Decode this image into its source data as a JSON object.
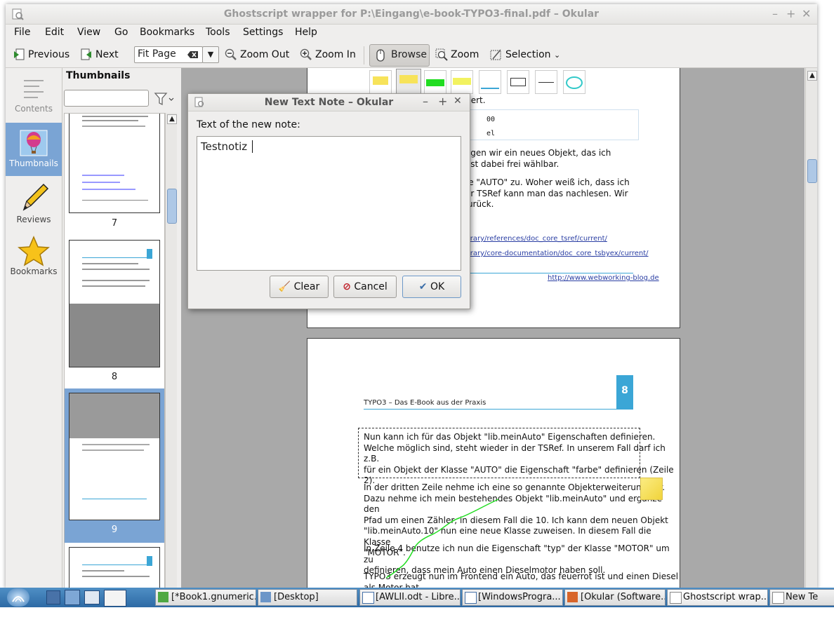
{
  "window": {
    "title": "Ghostscript wrapper for P:\\Eingang\\e-book-TYPO3-final.pdf – Okular"
  },
  "menu": [
    "File",
    "Edit",
    "View",
    "Go",
    "Bookmarks",
    "Tools",
    "Settings",
    "Help"
  ],
  "toolbar": {
    "previous": "Previous",
    "next": "Next",
    "zoom_mode": "Fit Page",
    "zoom_out": "Zoom Out",
    "zoom_in": "Zoom In",
    "browse": "Browse",
    "zoom": "Zoom",
    "selection": "Selection"
  },
  "sidebar": {
    "items": [
      {
        "label": "Contents"
      },
      {
        "label": "Thumbnails"
      },
      {
        "label": "Reviews"
      },
      {
        "label": "Bookmarks"
      }
    ]
  },
  "thumbnails": {
    "title": "Thumbnails",
    "pages": [
      "7",
      "8",
      "9"
    ]
  },
  "document": {
    "page_top": {
      "frag1": "mmiert.",
      "frag2": "00",
      "frag3": "el",
      "p1": [
        "rzeugen wir ein neues Objekt, das ich",
        "me ist dabei frei wählbar."
      ],
      "p2": [
        "lasse \"AUTO\" zu. Woher weiß ich, dass ich",
        "n der TSRef kann man das nachlesen. Wir",
        "uf zurück."
      ],
      "link1": "nt-library/references/doc_core_tsref/current/",
      "link2": "nt-library/core-documentation/doc_core_tsbyex/current/",
      "footer_link": "http://www.webworking-blog.de"
    },
    "page8": {
      "number": "8",
      "header": "TYPO3 – Das E-Book aus der Praxis",
      "box_para": [
        "Nun kann ich für das Objekt \"lib.meinAuto\" Eigenschaften definieren.",
        "Welche möglich sind, steht wieder in der TSRef. In unserem Fall darf ich z.B.",
        "für ein Objekt der Klasse \"AUTO\" die Eigenschaft \"farbe\" definieren (Zeile",
        "2)."
      ],
      "para2": [
        "In der dritten Zeile nehme ich eine so genannte Objekterweiterung vor.",
        "Dazu nehme ich mein bestehendes Objekt \"lib.meinAuto\" und ergänze den",
        "Pfad um einen Zähler, in diesem Fall die 10. Ich kann dem neuen Objekt",
        "\"lib.meinAuto.10\" nun eine neue Klasse zuweisen. In diesem Fall die Klasse",
        "\"MOTOR\"."
      ],
      "para3": [
        "In Zeile 4 benutze ich nun die Eigenschaft \"typ\" der Klasse \"MOTOR\" um zu",
        "definieren, dass mein Auto einen Dieselmotor haben soll."
      ],
      "para4": [
        "TYPO3 erzeugt nun im Frontend ein Auto, das feuerrot ist und einen Diesel",
        "als Motor hat."
      ]
    }
  },
  "dialog": {
    "title": "New Text Note – Okular",
    "label": "Text of the new note:",
    "note_text": "Testnotiz",
    "clear": "Clear",
    "cancel": "Cancel",
    "ok": "OK"
  },
  "taskbar": {
    "tasks": [
      "[*Book1.gnumeric...",
      "[Desktop]",
      "[AWLII.odt - Libre...",
      "[WindowsProgra...",
      "[Okular (Software...",
      "Ghostscript wrap...",
      "New Te"
    ]
  },
  "colors": {
    "accent": "#7aa4d4",
    "page_number_bg": "#3ba6d6",
    "ink_green": "#22dd22",
    "note_yellow": "#f7e35a"
  }
}
